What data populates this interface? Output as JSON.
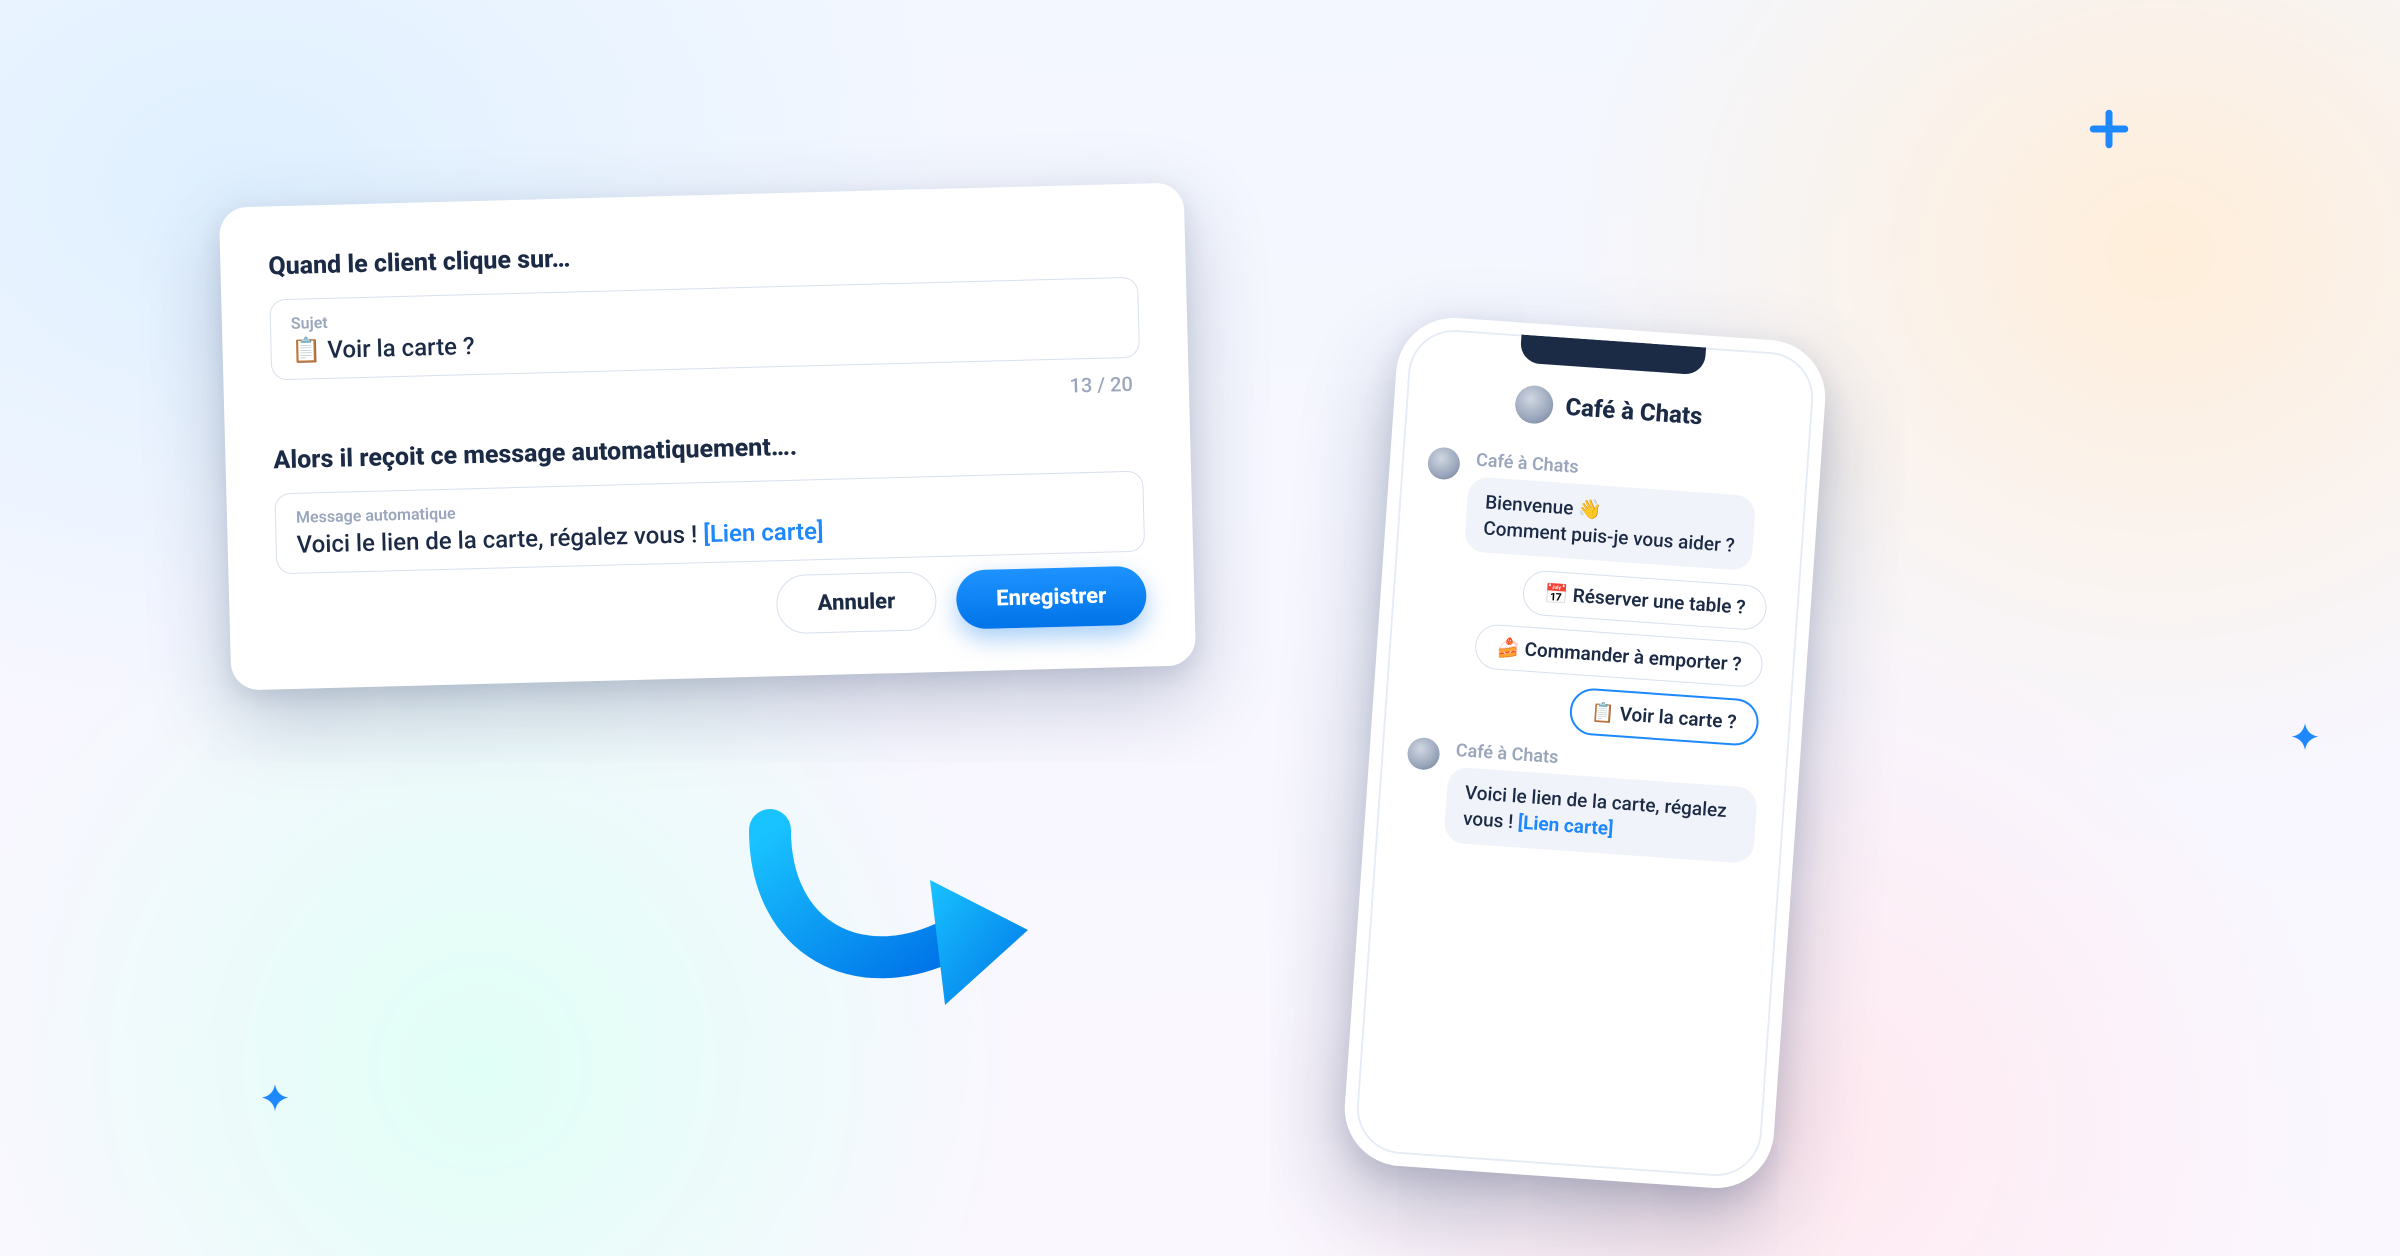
{
  "form": {
    "section1_title": "Quand le client clique sur…",
    "subject_label": "Sujet",
    "subject_value": "📋 Voir la carte ?",
    "counter": "13 / 20",
    "section2_title": "Alors il reçoit ce message automatiquement….",
    "auto_label": "Message automatique",
    "auto_value_text": "Voici le lien de la carte, régalez vous ! ",
    "auto_value_link": "[Lien carte]",
    "cancel": "Annuler",
    "save": "Enregistrer"
  },
  "phone": {
    "title": "Café à Chats",
    "sender": "Café à Chats",
    "welcome_line1": "Bienvenue 👋",
    "welcome_line2": "Comment puis-je vous aider ?",
    "options": [
      "📅 Réserver une table ?",
      "🍰 Commander à emporter ?",
      "📋 Voir la carte ?"
    ],
    "reply_text": "Voici le lien de la carte, régalez vous ! ",
    "reply_link": "[Lien carte]"
  },
  "colors": {
    "accent": "#1e88ff",
    "text": "#1c2b45",
    "muted": "#9aa6bb"
  }
}
